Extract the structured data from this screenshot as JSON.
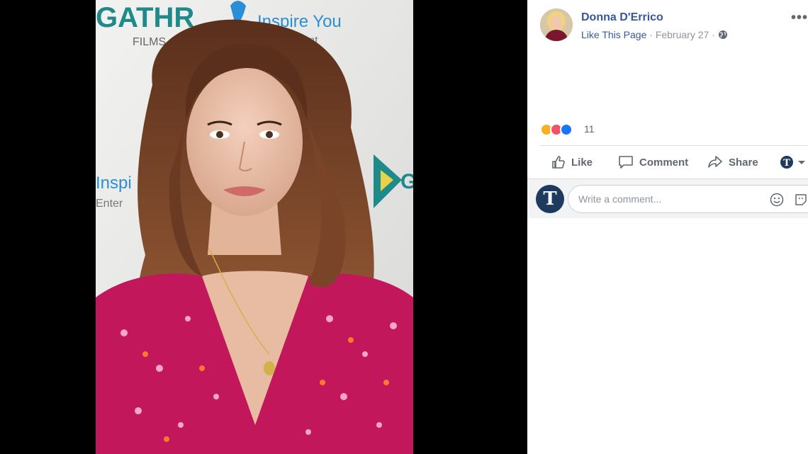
{
  "post": {
    "page_name": "Donna D'Errico",
    "like_page_label": "Like This Page",
    "separator": "·",
    "date": "February 27",
    "more_label": "•••",
    "privacy_icon": "globe-icon"
  },
  "reactions": {
    "types": [
      "sad",
      "love",
      "like"
    ],
    "count": "11"
  },
  "actions": {
    "like_label": "Like",
    "comment_label": "Comment",
    "share_label": "Share"
  },
  "comment": {
    "placeholder": "Write a comment...",
    "avatar_letter": "T"
  },
  "photo": {
    "backdrop_text": {
      "brand": "GATHR",
      "films": "FILMS",
      "inspire": "Inspire You",
      "inspire_sub": "ertainment",
      "side": "Inspi",
      "side_sub": "Enter",
      "right": "G"
    }
  },
  "colors": {
    "link": "#365899",
    "muted": "#90949c",
    "action": "#606770",
    "dress": "#c2185b",
    "hair": "#6b3a22"
  }
}
